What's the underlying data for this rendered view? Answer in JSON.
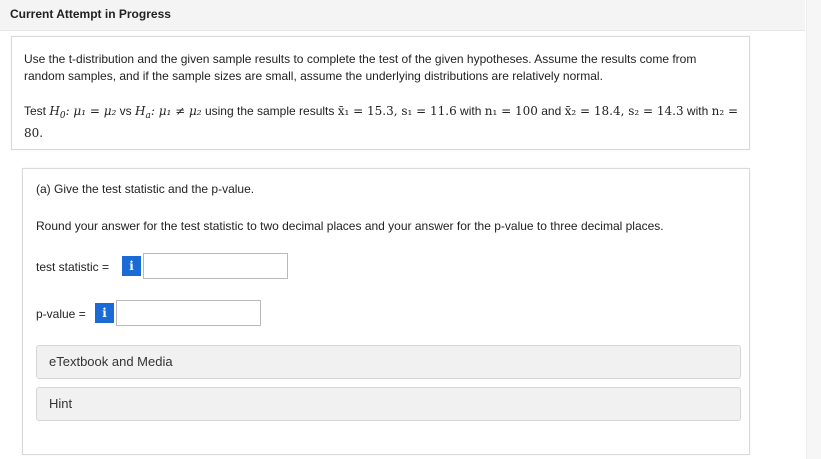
{
  "header": {
    "title": "Current Attempt in Progress"
  },
  "problem": {
    "text": "Use the t-distribution and the given sample results to complete the test of the given hypotheses. Assume the results come from random samples, and if the sample sizes are small, assume the underlying distributions are relatively normal.",
    "test_prefix": "Test",
    "h0_label": "H",
    "h0_sub": "0",
    "null_hypothesis": ": μ₁ = μ₂",
    "vs": "vs",
    "ha_label": "H",
    "ha_sub": "a",
    "alt_hypothesis": ": μ₁ ≠ μ₂",
    "using_text": "using the sample results",
    "sample1": "x̄₁ = 15.3, s₁ = 11.6",
    "with1": "with",
    "n1": "n₁ = 100",
    "and": "and",
    "sample2": "x̄₂ = 18.4, s₂ = 14.3",
    "with2": "with",
    "n2": "n₂ = 80."
  },
  "part_a": {
    "label": "(a) Give the test statistic and the p-value.",
    "instructions": "Round your answer for the test statistic to two decimal places and your answer for the p-value to three decimal places.",
    "test_statistic_label": "test statistic =",
    "test_statistic_value": "",
    "p_value_label": "p-value =",
    "p_value_value": "",
    "info_glyph": "i"
  },
  "resources": {
    "etextbook": "eTextbook and Media",
    "hint": "Hint"
  },
  "colors": {
    "info_button": "#1a6bd6",
    "banner_bg": "#f4f4f4",
    "resource_bg": "#f1f1f1"
  }
}
